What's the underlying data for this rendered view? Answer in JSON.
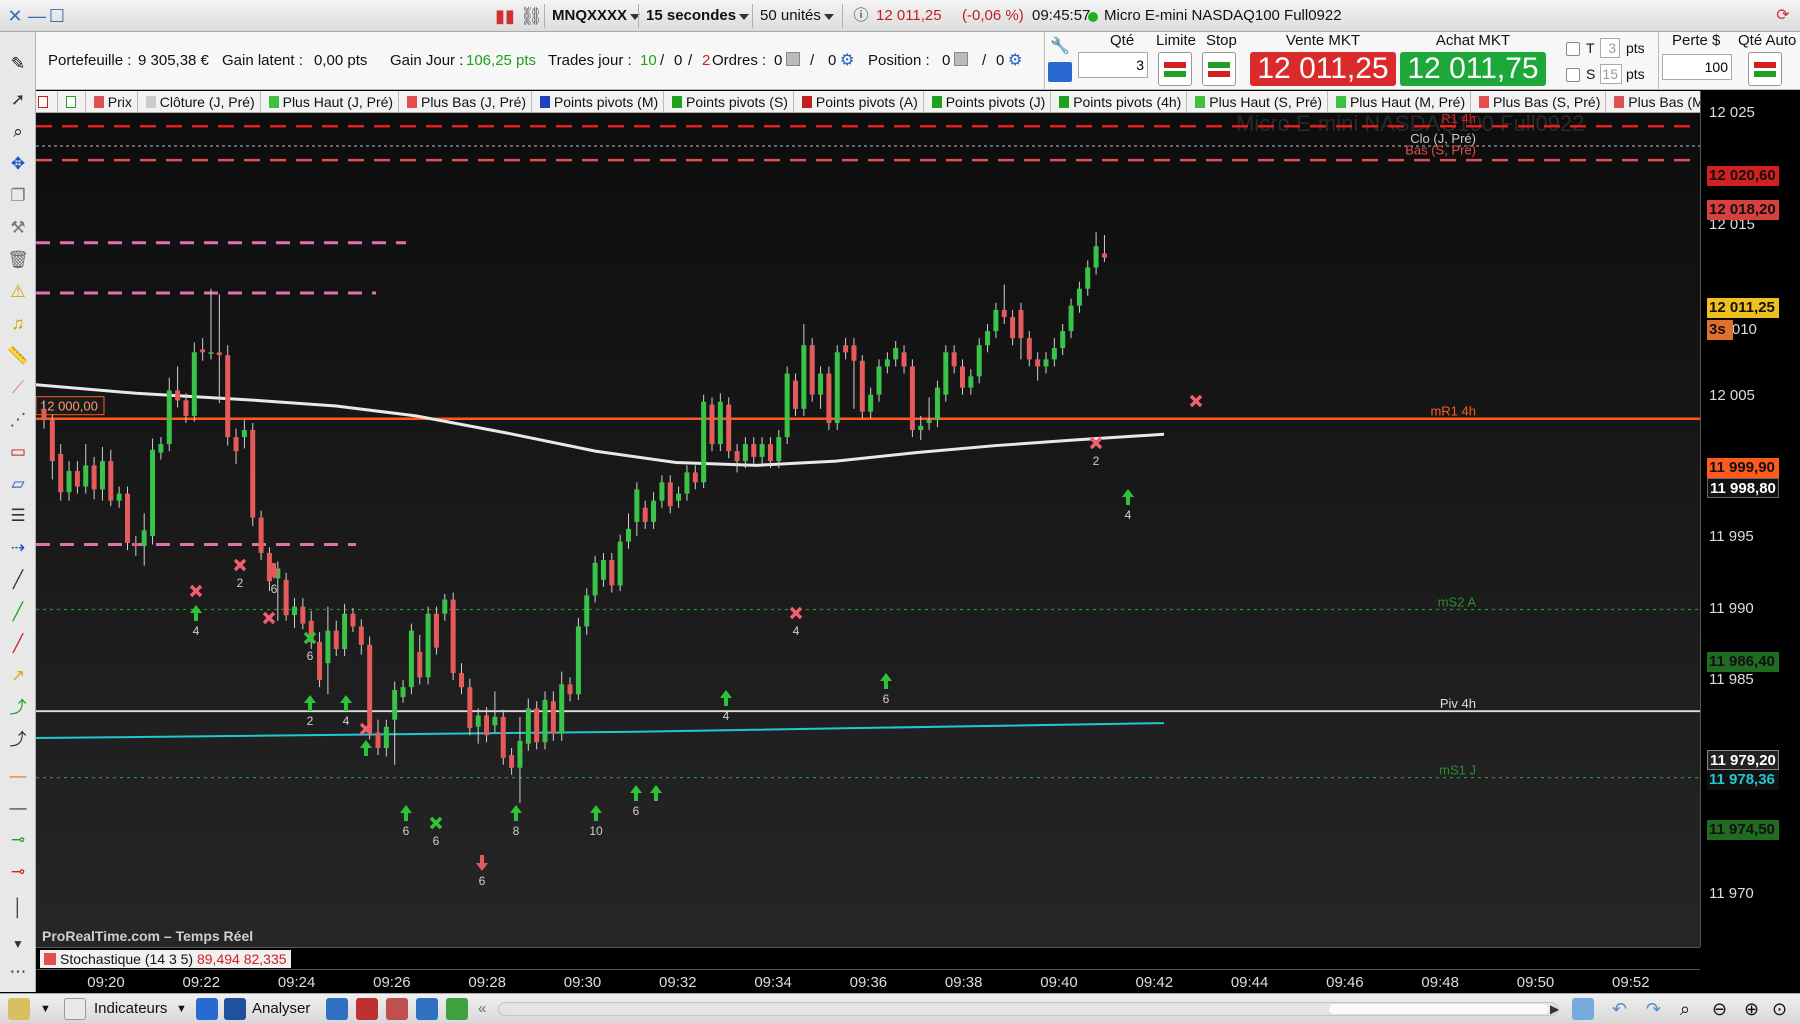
{
  "titlebar": {
    "symbol": "MNQXXXX",
    "timeframe": "15 secondes",
    "units": "50 unités",
    "last_price": "12 011,25",
    "change": "(-0,06 %)",
    "time": "09:45:57",
    "instrument": "Micro E-mini NASDAQ100 Full0922"
  },
  "infobar": {
    "portfolio_label": "Portefeuille :",
    "portfolio_value": "9 305,38 €",
    "unrealized_label": "Gain latent :",
    "unrealized_value": "0,00 pts",
    "day_gain_label": "Gain Jour :",
    "day_gain_value": "106,25 pts",
    "trades_label": "Trades jour :",
    "trades_total": "10",
    "trades_sep1": "/",
    "trades_mid": "0",
    "trades_sep2": "/",
    "trades_loss": "2",
    "orders_label": "Ordres :",
    "orders_a": "0",
    "orders_b": "0",
    "position_label": "Position :",
    "position_a": "0",
    "position_b": "0",
    "qty_label": "Qté",
    "qty_value": "3",
    "limit_label": "Limite",
    "stop_label": "Stop",
    "sell_label": "Vente MKT",
    "sell_price": "12 011,25",
    "buy_label": "Achat MKT",
    "buy_price": "12 011,75",
    "t_label": "T",
    "t_value": "3",
    "t_unit": "pts",
    "s_label": "S",
    "s_value": "15",
    "s_unit": "pts",
    "loss_label": "Perte $",
    "loss_value": "100",
    "auto_qty_label": "Qté Auto"
  },
  "legend": [
    {
      "label": "Prix",
      "color": "#e05050"
    },
    {
      "label": "Clôture (J, Pré)",
      "color": "#cccccc"
    },
    {
      "label": "Plus Haut (J, Pré)",
      "color": "#40c040"
    },
    {
      "label": "Plus Bas (J, Pré)",
      "color": "#e05050"
    },
    {
      "label": "Points pivots (M)",
      "color": "#2040c0"
    },
    {
      "label": "Points pivots (S)",
      "color": "#20a020"
    },
    {
      "label": "Points pivots (A)",
      "color": "#c02020"
    },
    {
      "label": "Points pivots (J)",
      "color": "#20a020"
    },
    {
      "label": "Points pivots (4h)",
      "color": "#20a020"
    },
    {
      "label": "Plus Haut (S, Pré)",
      "color": "#40c040"
    },
    {
      "label": "Plus Haut (M, Pré)",
      "color": "#40c040"
    },
    {
      "label": "Plus Bas (S, Pré)",
      "color": "#e05050"
    },
    {
      "label": "Plus Bas (M,",
      "color": "#e05050"
    }
  ],
  "chart_title_overlay": "Micro E-mini NASDAQ100 Full0922",
  "price_axis": [
    "12 025",
    "12 015",
    "12 010",
    "12 005",
    "11 995",
    "11 990",
    "11 985",
    "11 970"
  ],
  "price_markers": {
    "r1": {
      "label": "R1 4h",
      "value": "12 020,60",
      "color": "#e02020"
    },
    "clo": {
      "label": "Clo (J, Pré)",
      "color": "#cccccc"
    },
    "bas": {
      "label": "Bas (S, Pré)",
      "value": "12 018,20",
      "color": "#e05050"
    },
    "last": {
      "value": "12 011,25",
      "countdown": "3s"
    },
    "mr1": {
      "label": "mR1 4h",
      "value": "11 999,90",
      "color": "#ff5a1e"
    },
    "ma": {
      "value": "11 998,80"
    },
    "ms2": {
      "label": "mS2 A",
      "value": "11 986,40",
      "color": "#2d8c2d"
    },
    "piv": {
      "label": "Piv 4h",
      "value": "11 979,20",
      "color": "#dddddd"
    },
    "cyan": {
      "value": "11 978,36",
      "color": "#20c8d0"
    },
    "ms1": {
      "label": "mS1 J",
      "value": "11 974,50",
      "color": "#2d8c2d"
    },
    "level_box": "12 000,00"
  },
  "trade_labels": [
    "2",
    "4",
    "2",
    "6",
    "2",
    "4",
    "6",
    "2",
    "6",
    "6",
    "8",
    "10",
    "6",
    "4",
    "4",
    "6",
    "2",
    "4"
  ],
  "watermark": "ProRealTime.com – Temps Réel",
  "stochastic": {
    "label": "Stochastique (14 3 5)",
    "k": "89,494",
    "d": "82,335"
  },
  "time_axis": [
    "09:20",
    "09:22",
    "09:24",
    "09:26",
    "09:28",
    "09:30",
    "09:32",
    "09:34",
    "09:36",
    "09:38",
    "09:40",
    "09:42",
    "09:44",
    "09:46",
    "09:48",
    "09:50",
    "09:52"
  ],
  "bottombar": {
    "indicators": "Indicateurs",
    "analyze": "Analyser"
  },
  "chart_data": {
    "type": "candlestick",
    "instrument": "Micro E-mini NASDAQ100 Full0922",
    "timeframe": "15 secondes",
    "ylim": [
      11968,
      12027
    ],
    "yticks": [
      12025,
      12015,
      12010,
      12005,
      11995,
      11990,
      11985,
      11970
    ],
    "levels": [
      {
        "name": "R1 4h",
        "value": 12020.6
      },
      {
        "name": "Bas (S, Pré)",
        "value": 12018.2
      },
      {
        "name": "mR1 4h",
        "value": 11999.9
      },
      {
        "name": "MA",
        "value": 11998.8
      },
      {
        "name": "mS2 A",
        "value": 11986.4
      },
      {
        "name": "Piv 4h",
        "value": 11979.2
      },
      {
        "name": "cyan",
        "value": 11978.36
      },
      {
        "name": "mS1 J",
        "value": 11974.5
      }
    ],
    "last": 12011.25
  }
}
